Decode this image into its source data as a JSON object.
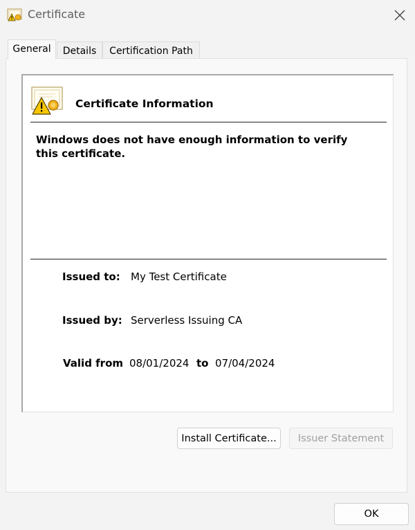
{
  "window": {
    "title": "Certificate"
  },
  "tabs": [
    {
      "label": "General",
      "active": true
    },
    {
      "label": "Details",
      "active": false
    },
    {
      "label": "Certification Path",
      "active": false
    }
  ],
  "certificate": {
    "header": "Certificate Information",
    "warning": "Windows does not have enough information to verify this certificate.",
    "issued_to_label": "Issued to:",
    "issued_to": "My Test Certificate",
    "issued_by_label": "Issued by:",
    "issued_by": "Serverless Issuing CA",
    "valid_from_label": "Valid from",
    "valid_from": "08/01/2024",
    "valid_to_label": "to",
    "valid_to": "07/04/2024"
  },
  "buttons": {
    "install": "Install Certificate...",
    "issuer_statement": "Issuer Statement",
    "ok": "OK"
  },
  "colors": {
    "background": "#f3f3f3",
    "panel": "#f9f9f9",
    "content": "#ffffff",
    "disabled_text": "#a0a0a0"
  }
}
